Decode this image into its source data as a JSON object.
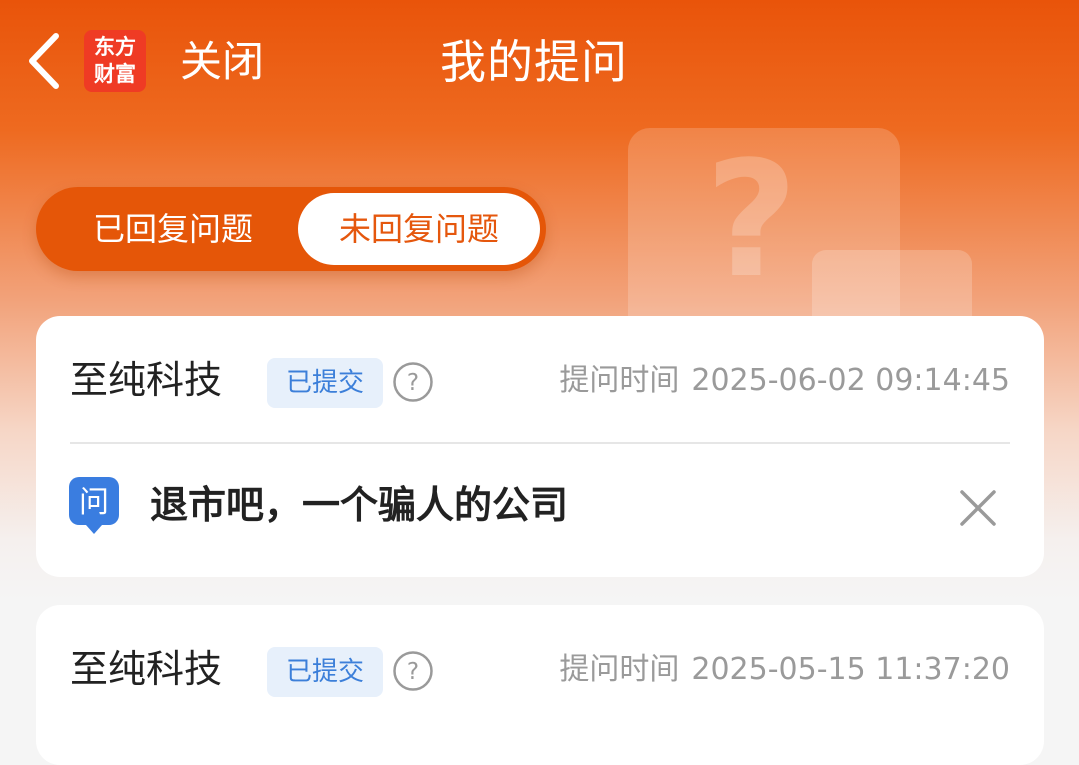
{
  "header": {
    "back_icon": "chevron-left-icon",
    "logo_lines": [
      "东方",
      "财富"
    ],
    "close_label": "关闭",
    "title": "我的提问"
  },
  "tabs": [
    {
      "label": "已回复问题",
      "active": false
    },
    {
      "label": "未回复问题",
      "active": true
    }
  ],
  "questions": [
    {
      "company": "至纯科技",
      "status": "已提交",
      "time_label": "提问时间",
      "time": "2025-06-02 09:14:45",
      "q_icon_label": "问",
      "text": "退市吧，一个骗人的公司"
    },
    {
      "company": "至纯科技",
      "status": "已提交",
      "time_label": "提问时间",
      "time": "2025-05-15 11:37:20"
    }
  ],
  "colors": {
    "brand_orange": "#e9540a",
    "badge_blue": "#3c7fd9",
    "badge_bg": "#e7f0fb",
    "logo_red": "#ef3b24"
  }
}
